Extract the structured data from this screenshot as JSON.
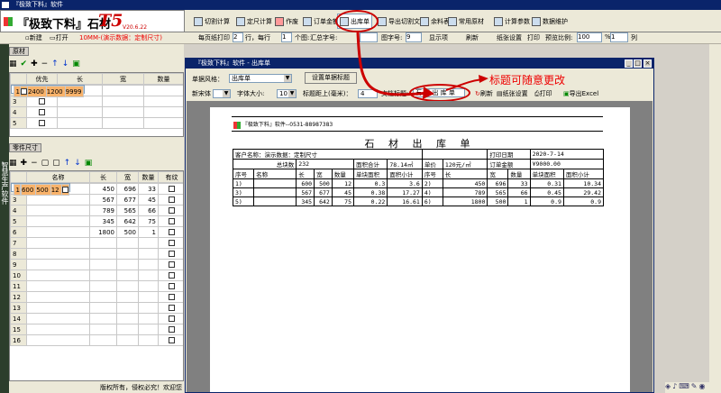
{
  "window": {
    "title": "『极致下料』软件"
  },
  "logo": {
    "text": "『极致下料』石材",
    "t5": "T5",
    "version": "V20.6.22"
  },
  "header_buttons": [
    "切割计算",
    "定尺计算",
    "作废",
    "订单金额",
    "出库单",
    "导出切割文件",
    "余料表",
    "常用原材",
    "计算参数",
    "数据维护"
  ],
  "toolbar2": {
    "new": "新建",
    "open": "打开",
    "hint": "10MM-(演示数据：定制尺寸)",
    "per_page_label": "每页纸打印",
    "per_page": "2",
    "row_label": "行，每行",
    "per_row": "1",
    "shape_label": "个图:",
    "summary_label": "汇总字号:",
    "summary_font": "",
    "shape_font_label": "图字号:",
    "shape_font": "9",
    "show_label": "显示项",
    "refresh": "刷新",
    "paper_setting": "纸张设置",
    "print": "打印",
    "preview_ratio_label": "预览比例:",
    "preview_ratio": "100",
    "ratio_sep": "%",
    "cols_value": "1",
    "cols_label": "列"
  },
  "raw_panel": {
    "section": "原材",
    "columns": [
      "优先",
      "长",
      "宽",
      "数量"
    ],
    "rows": [
      {
        "n": "1",
        "len": "2400",
        "wid": "1200",
        "qty": "9999"
      },
      {
        "n": "2",
        "len": "",
        "wid": "",
        "qty": ""
      },
      {
        "n": "3",
        "len": "",
        "wid": "",
        "qty": ""
      },
      {
        "n": "4",
        "len": "",
        "wid": "",
        "qty": ""
      },
      {
        "n": "5",
        "len": "",
        "wid": "",
        "qty": ""
      }
    ]
  },
  "parts_panel": {
    "section": "零件尺寸",
    "columns": [
      "名称",
      "长",
      "宽",
      "数量",
      "有纹"
    ],
    "rows": [
      {
        "n": "1",
        "len": "600",
        "wid": "500",
        "qty": "12"
      },
      {
        "n": "2",
        "len": "450",
        "wid": "696",
        "qty": "33"
      },
      {
        "n": "3",
        "len": "567",
        "wid": "677",
        "qty": "45"
      },
      {
        "n": "4",
        "len": "789",
        "wid": "565",
        "qty": "66"
      },
      {
        "n": "5",
        "len": "345",
        "wid": "642",
        "qty": "75"
      },
      {
        "n": "6",
        "len": "1800",
        "wid": "500",
        "qty": "1"
      },
      {
        "n": "7",
        "len": "",
        "wid": "",
        "qty": ""
      },
      {
        "n": "8",
        "len": "",
        "wid": "",
        "qty": ""
      },
      {
        "n": "9",
        "len": "",
        "wid": "",
        "qty": ""
      },
      {
        "n": "10",
        "len": "",
        "wid": "",
        "qty": ""
      },
      {
        "n": "11",
        "len": "",
        "wid": "",
        "qty": ""
      },
      {
        "n": "12",
        "len": "",
        "wid": "",
        "qty": ""
      },
      {
        "n": "13",
        "len": "",
        "wid": "",
        "qty": ""
      },
      {
        "n": "14",
        "len": "",
        "wid": "",
        "qty": ""
      },
      {
        "n": "15",
        "len": "",
        "wid": "",
        "qty": ""
      },
      {
        "n": "16",
        "len": "",
        "wid": "",
        "qty": ""
      }
    ]
  },
  "sidebar_text": "智慧生产软件",
  "status_left": "版权所有，侵权必究！欢迎您",
  "dialog": {
    "title": "『极致下料』软件 - 出库单",
    "style_label": "单据风格：",
    "style_value": "出库单",
    "set_title_btn": "设置单据标题",
    "font_label": "新宋体",
    "size_label": "字体大小:",
    "size_value": "10",
    "margin_label": "标题距上(毫米)：",
    "margin_value": "4",
    "doc_title_label": "文档标题:",
    "doc_title_value": "石 材 出 库 单",
    "refresh": "刷新",
    "paper_setting": "纸张设置",
    "print": "打印",
    "export": "导出Excel"
  },
  "report": {
    "company": "『极致下料』软件--0531-88987383",
    "title": "石 材 出 库 单",
    "customer_label": "客户名称：演示数据：定制尺寸",
    "print_date_label": "打印日期",
    "print_date": "2020-7-14",
    "total_qty_label": "总块数",
    "total_qty": "232",
    "area_total_label": "面积合计",
    "area_total": "78.14㎡",
    "unit_price_label": "单价",
    "unit_price": "120元/㎡",
    "order_amount_label": "订单金额",
    "order_amount": "¥9000.00",
    "cols": [
      "序号",
      "名称",
      "长",
      "宽",
      "数量",
      "单块面积",
      "面积小计"
    ],
    "left_rows": [
      [
        "1)",
        "",
        "600",
        "500",
        "12",
        "0.3",
        "3.6"
      ],
      [
        "3)",
        "",
        "567",
        "677",
        "45",
        "0.38",
        "17.27"
      ],
      [
        "5)",
        "",
        "345",
        "642",
        "75",
        "0.22",
        "16.61"
      ]
    ],
    "right_rows": [
      [
        "2)",
        "",
        "450",
        "696",
        "33",
        "0.31",
        "10.34"
      ],
      [
        "4)",
        "",
        "789",
        "565",
        "66",
        "0.45",
        "29.42"
      ],
      [
        "6)",
        "",
        "1800",
        "500",
        "1",
        "0.9",
        "0.9"
      ]
    ]
  },
  "annotation": "标题可随意更改",
  "colors": {
    "title_bar": "#0a246a",
    "selected_row": "#f9b36b",
    "annotation": "#ee0000",
    "highlight_ellipse": "#cc0000"
  }
}
